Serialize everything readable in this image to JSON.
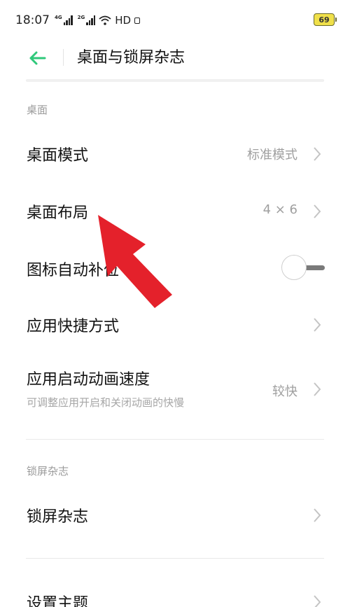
{
  "status_bar": {
    "time": "18:07",
    "signal1_label": "4G",
    "signal2_label": "2G",
    "hd_label": "HD",
    "battery": "69",
    "battery_color": "#f0e04a"
  },
  "header": {
    "title": "桌面与锁屏杂志",
    "back_icon": "back-arrow-icon",
    "accent_color": "#2fc87a"
  },
  "sections": [
    {
      "label": "桌面",
      "items": [
        {
          "title": "桌面模式",
          "value": "标准模式",
          "control": "chevron"
        },
        {
          "title": "桌面布局",
          "value": "4 × 6",
          "control": "chevron"
        },
        {
          "title": "图标自动补位",
          "value": "",
          "control": "toggle",
          "toggle_on": false
        },
        {
          "title": "应用快捷方式",
          "value": "",
          "control": "chevron"
        },
        {
          "title": "应用启动动画速度",
          "subtitle": "可调整应用开启和关闭动画的快慢",
          "value": "较快",
          "control": "chevron"
        }
      ]
    },
    {
      "label": "锁屏杂志",
      "items": [
        {
          "title": "锁屏杂志",
          "value": "",
          "control": "chevron"
        }
      ]
    },
    {
      "label": "",
      "items": [
        {
          "title": "设置主题",
          "value": "",
          "control": "chevron"
        }
      ]
    }
  ],
  "annotation": {
    "type": "red-arrow",
    "color": "#e4212b",
    "points_to": "桌面布局"
  }
}
